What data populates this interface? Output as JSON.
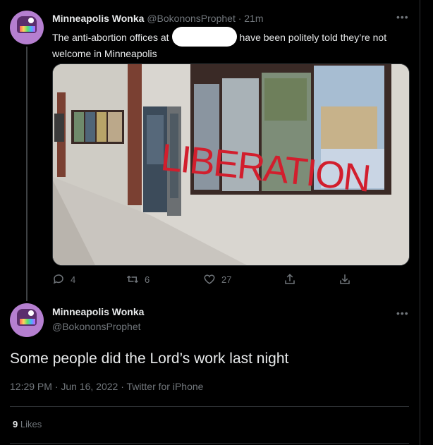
{
  "tweet1": {
    "display_name": "Minneapolis Wonka",
    "handle": "@BokononsProphet",
    "time": "· 21m",
    "text_before": "The anti-abortion offices at",
    "text_after": "have been politely told they’re not welcome in Minneapolis",
    "graffiti": "LIBERATION",
    "actions": {
      "reply_count": "4",
      "retweet_count": "6",
      "like_count": "27"
    }
  },
  "tweet2": {
    "display_name": "Minneapolis Wonka",
    "handle": "@BokononsProphet",
    "text": "Some people did the Lord’s work last night",
    "meta": "12:29 PM · Jun 16, 2022 · Twitter for iPhone",
    "likes_count": "9",
    "likes_label": "Likes"
  },
  "icons": {
    "more": "more-icon",
    "reply": "reply-icon",
    "retweet": "retweet-icon",
    "like": "like-icon",
    "share": "share-icon",
    "download": "download-icon"
  },
  "colors": {
    "background": "#000000",
    "text": "#e7e9ea",
    "muted": "#71767b",
    "graffiti": "#d21e2d"
  }
}
